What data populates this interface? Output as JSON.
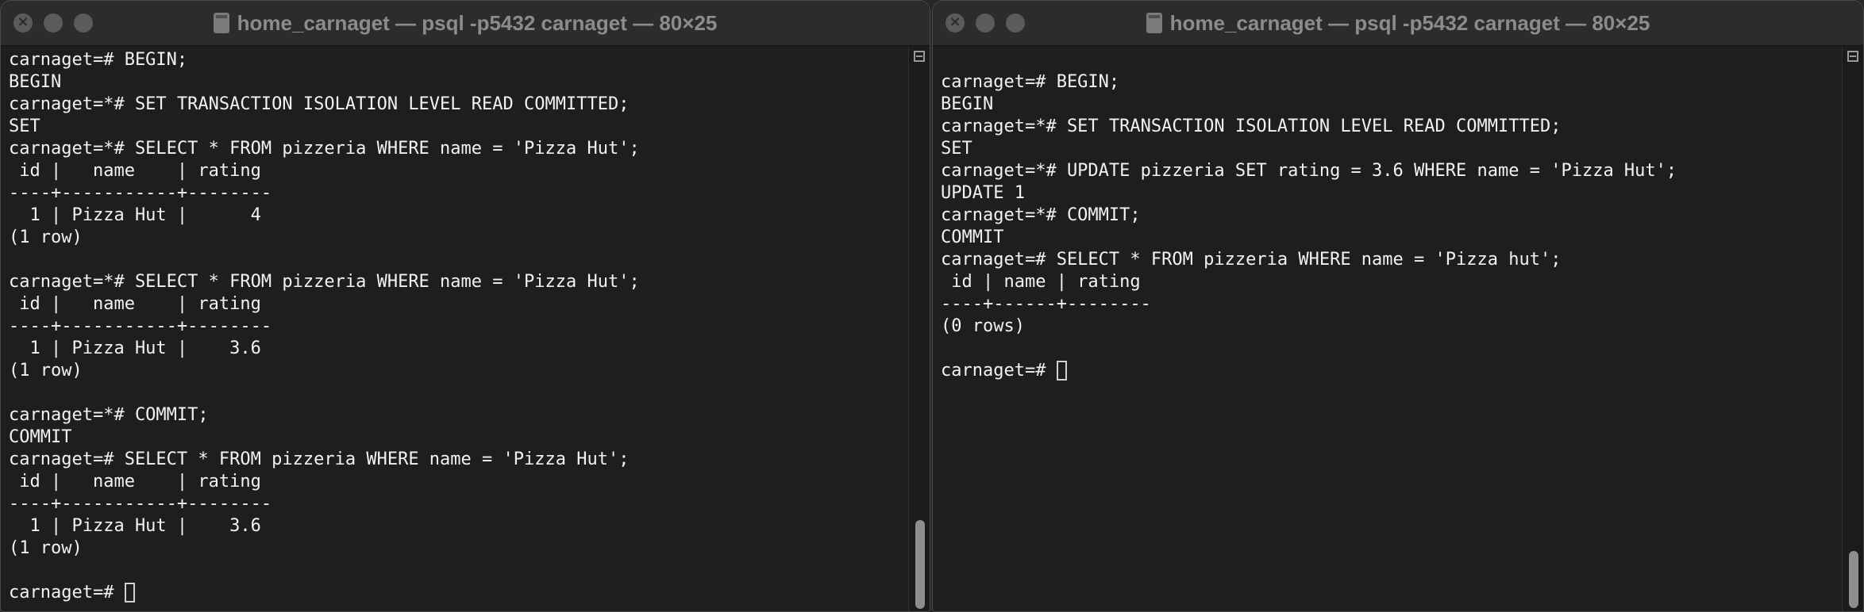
{
  "windows": [
    {
      "title": "home_carnaget — psql -p5432 carnaget — 80×25",
      "lines": [
        "carnaget=# BEGIN;",
        "BEGIN",
        "carnaget=*# SET TRANSACTION ISOLATION LEVEL READ COMMITTED;",
        "SET",
        "carnaget=*# SELECT * FROM pizzeria WHERE name = 'Pizza Hut';",
        " id |   name    | rating",
        "----+-----------+--------",
        "  1 | Pizza Hut |      4",
        "(1 row)",
        "",
        "carnaget=*# SELECT * FROM pizzeria WHERE name = 'Pizza Hut';",
        " id |   name    | rating",
        "----+-----------+--------",
        "  1 | Pizza Hut |    3.6",
        "(1 row)",
        "",
        "carnaget=*# COMMIT;",
        "COMMIT",
        "carnaget=# SELECT * FROM pizzeria WHERE name = 'Pizza Hut';",
        " id |   name    | rating",
        "----+-----------+--------",
        "  1 | Pizza Hut |    3.6",
        "(1 row)",
        ""
      ],
      "prompt": "carnaget=# "
    },
    {
      "title": "home_carnaget — psql -p5432 carnaget — 80×25",
      "lines": [
        "",
        "carnaget=# BEGIN;",
        "BEGIN",
        "carnaget=*# SET TRANSACTION ISOLATION LEVEL READ COMMITTED;",
        "SET",
        "carnaget=*# UPDATE pizzeria SET rating = 3.6 WHERE name = 'Pizza Hut';",
        "UPDATE 1",
        "carnaget=*# COMMIT;",
        "COMMIT",
        "carnaget=# SELECT * FROM pizzeria WHERE name = 'Pizza hut';",
        " id | name | rating",
        "----+------+--------",
        "(0 rows)",
        ""
      ],
      "prompt": "carnaget=# "
    }
  ],
  "icons": {
    "close": "close-icon",
    "minimize": "minimize-icon",
    "zoom": "zoom-icon",
    "terminal": "terminal-icon",
    "scroll_toggle": "split-view-icon"
  }
}
